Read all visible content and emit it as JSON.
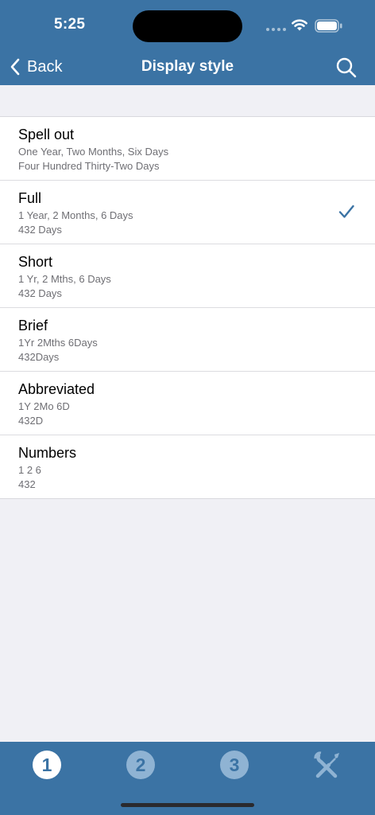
{
  "status": {
    "time": "5:25"
  },
  "nav": {
    "back_label": "Back",
    "title": "Display style"
  },
  "options": [
    {
      "title": "Spell out",
      "line1": "One Year, Two Months, Six Days",
      "line2": "Four Hundred Thirty-Two Days",
      "selected": false
    },
    {
      "title": "Full",
      "line1": "1 Year, 2 Months, 6 Days",
      "line2": "432 Days",
      "selected": true
    },
    {
      "title": "Short",
      "line1": "1 Yr, 2 Mths, 6 Days",
      "line2": "432 Days",
      "selected": false
    },
    {
      "title": "Brief",
      "line1": "1Yr 2Mths 6Days",
      "line2": "432Days",
      "selected": false
    },
    {
      "title": "Abbreviated",
      "line1": "1Y 2Mo 6D",
      "line2": "432D",
      "selected": false
    },
    {
      "title": "Numbers",
      "line1": "1 2 6",
      "line2": "432",
      "selected": false
    }
  ],
  "tabs": [
    {
      "label": "1",
      "icon": "number-1-icon",
      "active": true
    },
    {
      "label": "2",
      "icon": "number-2-icon",
      "active": false
    },
    {
      "label": "3",
      "icon": "number-3-icon",
      "active": false
    },
    {
      "label": "",
      "icon": "tools-icon",
      "active": false
    }
  ],
  "colors": {
    "bar": "#3b73a4",
    "accent": "#3b73a4",
    "inactive_tab": "#8fb3d3"
  }
}
